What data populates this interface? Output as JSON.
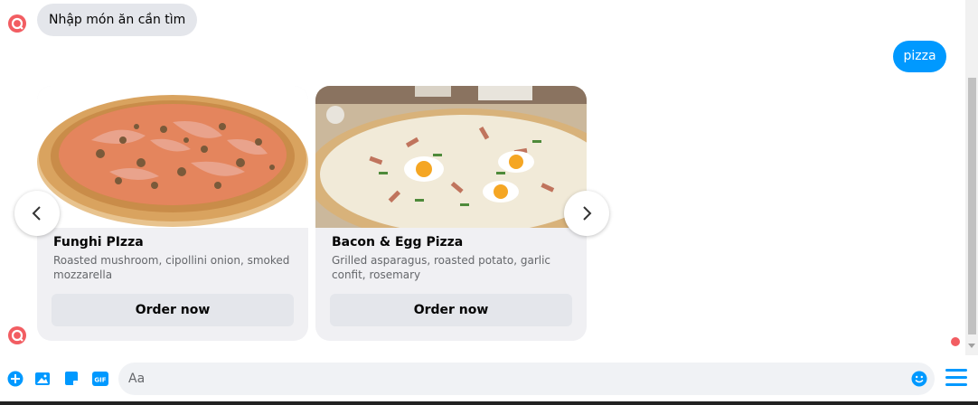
{
  "messages": {
    "incoming": "Nhập món ăn cần tìm",
    "outgoing": "pizza"
  },
  "cards": [
    {
      "title": "Funghi PIzza",
      "description": "Roasted mushroom, cipollini onion, smoked mozzarella",
      "button": "Order now"
    },
    {
      "title": "Bacon & Egg Pizza",
      "description": "Grilled asparagus, roasted potato, garlic confit, rosemary",
      "button": "Order now"
    }
  ],
  "composer": {
    "placeholder": "Aa",
    "tools": [
      "plus-circle-icon",
      "photo-icon",
      "sticker-icon",
      "gif-icon"
    ],
    "gif_label": "GIF"
  },
  "colors": {
    "accent": "#0099ff",
    "bot_avatar": "#f25d62",
    "bubble_incoming": "#e4e6eb",
    "card_bg": "#f0f0f3"
  }
}
